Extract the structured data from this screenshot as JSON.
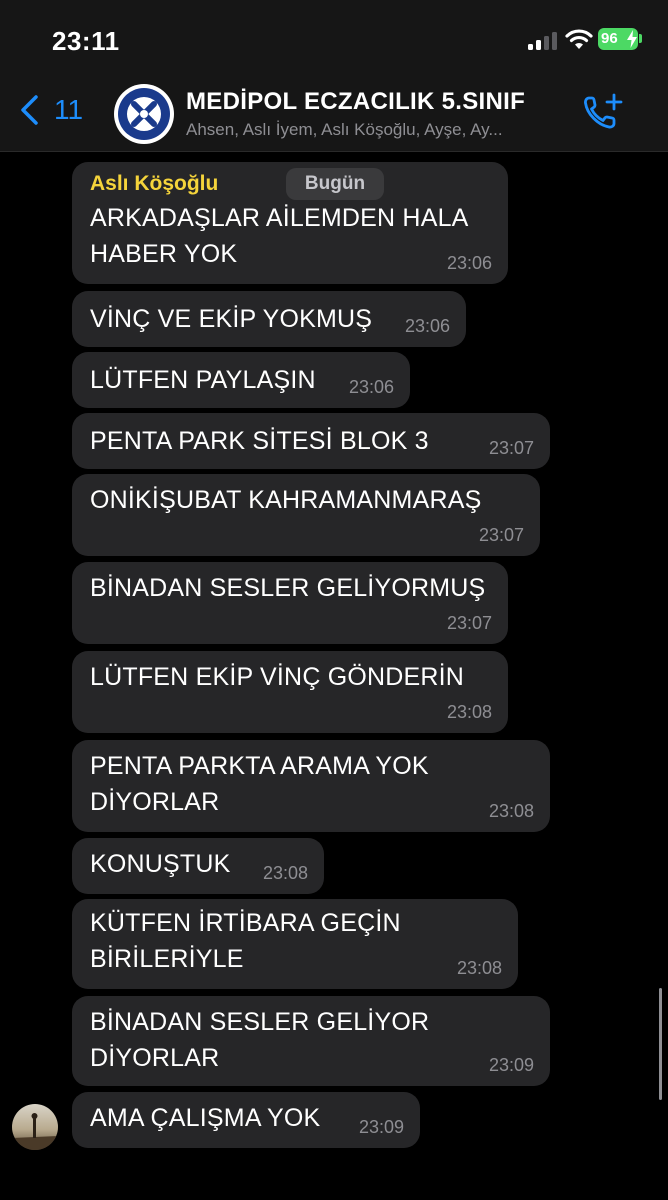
{
  "status": {
    "time": "23:11",
    "battery": "96"
  },
  "nav": {
    "back_count": "11",
    "group_name": "MEDİPOL ECZACILIK 5.SINIF",
    "members": "Ahsen, Aslı İyem, Aslı Köşoğlu, Ayşe, Ay..."
  },
  "chat": {
    "date_label": "Bugün",
    "sender": "Aslı Köşoğlu",
    "messages": [
      {
        "text": "ARKADAŞLAR AİLEMDEN HALA\nHABER YOK",
        "time": "23:06"
      },
      {
        "text": "VİNÇ VE EKİP YOKMUŞ",
        "time": "23:06"
      },
      {
        "text": "LÜTFEN PAYLAŞIN",
        "time": "23:06"
      },
      {
        "text": "PENTA PARK SİTESİ BLOK 3",
        "time": "23:07"
      },
      {
        "text": "ONİKİŞUBAT KAHRAMANMARAŞ",
        "time": "23:07"
      },
      {
        "text": "BİNADAN SESLER GELİYORMUŞ",
        "time": "23:07"
      },
      {
        "text": "LÜTFEN EKİP VİNÇ GÖNDERİN",
        "time": "23:08"
      },
      {
        "text": "PENTA PARKTA ARAMA YOK\nDİYORLAR",
        "time": "23:08"
      },
      {
        "text": "KONUŞTUK",
        "time": "23:08"
      },
      {
        "text": "KÜTFEN İRTİBARA GEÇİN\nBİRİLERİYLE",
        "time": "23:08"
      },
      {
        "text": "BİNADAN SESLER GELİYOR\nDİYORLAR",
        "time": "23:09"
      },
      {
        "text": "AMA ÇALIŞMA YOK",
        "time": "23:09"
      }
    ]
  },
  "colors": {
    "accent": "#1d8dfb",
    "sender_name": "#f5d43b",
    "bubble": "#262628",
    "battery": "#4cd964"
  },
  "icons": [
    "back-chevron-icon",
    "signal-icon",
    "wifi-icon",
    "battery-icon",
    "group-logo-icon",
    "add-call-icon"
  ]
}
